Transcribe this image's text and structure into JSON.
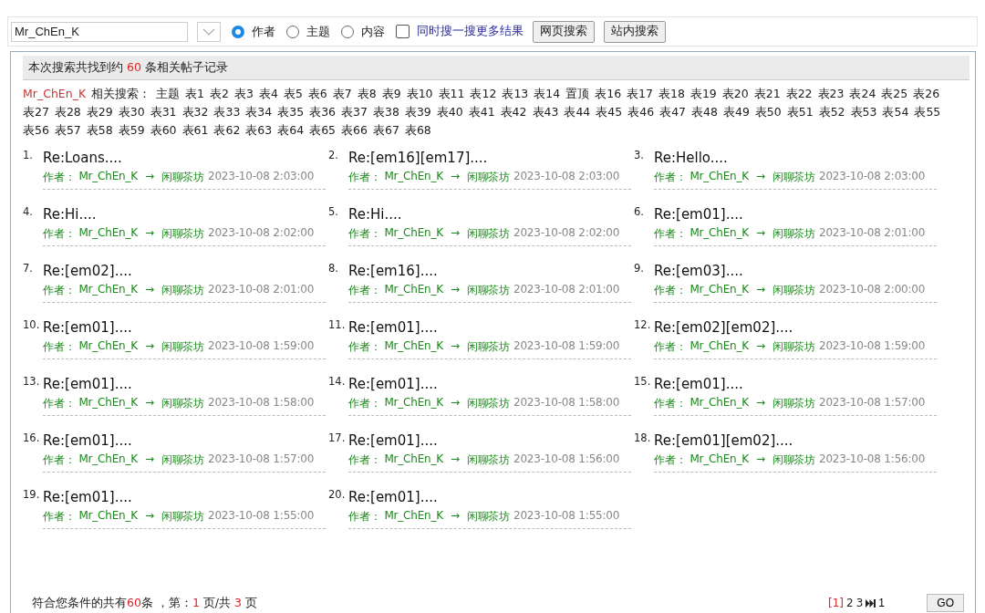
{
  "search_bar": {
    "query": "Mr_ChEn_K",
    "scopes": [
      {
        "label": "作者",
        "selected": true
      },
      {
        "label": "主题",
        "selected": false
      },
      {
        "label": "内容",
        "selected": false
      }
    ],
    "more_results": {
      "label": "同时搜一搜更多结果",
      "checked": false
    },
    "buttons": [
      "网页搜索",
      "站内搜索"
    ]
  },
  "summary": {
    "prefix": "本次搜索共找到约 ",
    "count": "60",
    "suffix": " 条相关帖子记录"
  },
  "related": {
    "user": "Mr_ChEn_K",
    "label": "相关搜索：",
    "tags": [
      "主题",
      "表1",
      "表2",
      "表3",
      "表4",
      "表5",
      "表6",
      "表7",
      "表8",
      "表9",
      "表10",
      "表11",
      "表12",
      "表13",
      "表14",
      "置顶",
      "表16",
      "表17",
      "表18",
      "表19",
      "表20",
      "表21",
      "表22",
      "表23",
      "表24",
      "表25",
      "表26",
      "表27",
      "表28",
      "表29",
      "表30",
      "表31",
      "表32",
      "表33",
      "表34",
      "表35",
      "表36",
      "表37",
      "表38",
      "表39",
      "表40",
      "表41",
      "表42",
      "表43",
      "表44",
      "表45",
      "表46",
      "表47",
      "表48",
      "表49",
      "表50",
      "表51",
      "表52",
      "表53",
      "表54",
      "表55",
      "表56",
      "表57",
      "表58",
      "表59",
      "表60",
      "表61",
      "表62",
      "表63",
      "表64",
      "表65",
      "表66",
      "表67",
      "表68"
    ]
  },
  "results": [
    {
      "number": "1.",
      "title": "Re:Loans....",
      "author_label": "作者：",
      "author": "Mr_ChEn_K",
      "arrow": "→",
      "forum": "闲聊茶坊",
      "time": "2023-10-08 2:03:00"
    },
    {
      "number": "2.",
      "title": "Re:[em16][em17]....",
      "author_label": "作者：",
      "author": "Mr_ChEn_K",
      "arrow": "→",
      "forum": "闲聊茶坊",
      "time": "2023-10-08 2:03:00"
    },
    {
      "number": "3.",
      "title": "Re:Hello....",
      "author_label": "作者：",
      "author": "Mr_ChEn_K",
      "arrow": "→",
      "forum": "闲聊茶坊",
      "time": "2023-10-08 2:03:00"
    },
    {
      "number": "4.",
      "title": "Re:Hi....",
      "author_label": "作者：",
      "author": "Mr_ChEn_K",
      "arrow": "→",
      "forum": "闲聊茶坊",
      "time": "2023-10-08 2:02:00"
    },
    {
      "number": "5.",
      "title": "Re:Hi....",
      "author_label": "作者：",
      "author": "Mr_ChEn_K",
      "arrow": "→",
      "forum": "闲聊茶坊",
      "time": "2023-10-08 2:02:00"
    },
    {
      "number": "6.",
      "title": "Re:[em01]....",
      "author_label": "作者：",
      "author": "Mr_ChEn_K",
      "arrow": "→",
      "forum": "闲聊茶坊",
      "time": "2023-10-08 2:01:00"
    },
    {
      "number": "7.",
      "title": "Re:[em02]....",
      "author_label": "作者：",
      "author": "Mr_ChEn_K",
      "arrow": "→",
      "forum": "闲聊茶坊",
      "time": "2023-10-08 2:01:00"
    },
    {
      "number": "8.",
      "title": "Re:[em16]....",
      "author_label": "作者：",
      "author": "Mr_ChEn_K",
      "arrow": "→",
      "forum": "闲聊茶坊",
      "time": "2023-10-08 2:01:00"
    },
    {
      "number": "9.",
      "title": "Re:[em03]....",
      "author_label": "作者：",
      "author": "Mr_ChEn_K",
      "arrow": "→",
      "forum": "闲聊茶坊",
      "time": "2023-10-08 2:00:00"
    },
    {
      "number": "10.",
      "title": "Re:[em01]....",
      "author_label": "作者：",
      "author": "Mr_ChEn_K",
      "arrow": "→",
      "forum": "闲聊茶坊",
      "time": "2023-10-08 1:59:00"
    },
    {
      "number": "11.",
      "title": "Re:[em01]....",
      "author_label": "作者：",
      "author": "Mr_ChEn_K",
      "arrow": "→",
      "forum": "闲聊茶坊",
      "time": "2023-10-08 1:59:00"
    },
    {
      "number": "12.",
      "title": "Re:[em02][em02]....",
      "author_label": "作者：",
      "author": "Mr_ChEn_K",
      "arrow": "→",
      "forum": "闲聊茶坊",
      "time": "2023-10-08 1:59:00"
    },
    {
      "number": "13.",
      "title": "Re:[em01]....",
      "author_label": "作者：",
      "author": "Mr_ChEn_K",
      "arrow": "→",
      "forum": "闲聊茶坊",
      "time": "2023-10-08 1:58:00"
    },
    {
      "number": "14.",
      "title": "Re:[em01]....",
      "author_label": "作者：",
      "author": "Mr_ChEn_K",
      "arrow": "→",
      "forum": "闲聊茶坊",
      "time": "2023-10-08 1:58:00"
    },
    {
      "number": "15.",
      "title": "Re:[em01]....",
      "author_label": "作者：",
      "author": "Mr_ChEn_K",
      "arrow": "→",
      "forum": "闲聊茶坊",
      "time": "2023-10-08 1:57:00"
    },
    {
      "number": "16.",
      "title": "Re:[em01]....",
      "author_label": "作者：",
      "author": "Mr_ChEn_K",
      "arrow": "→",
      "forum": "闲聊茶坊",
      "time": "2023-10-08 1:57:00"
    },
    {
      "number": "17.",
      "title": "Re:[em01]....",
      "author_label": "作者：",
      "author": "Mr_ChEn_K",
      "arrow": "→",
      "forum": "闲聊茶坊",
      "time": "2023-10-08 1:56:00"
    },
    {
      "number": "18.",
      "title": "Re:[em01][em02]....",
      "author_label": "作者：",
      "author": "Mr_ChEn_K",
      "arrow": "→",
      "forum": "闲聊茶坊",
      "time": "2023-10-08 1:56:00"
    },
    {
      "number": "19.",
      "title": "Re:[em01]....",
      "author_label": "作者：",
      "author": "Mr_ChEn_K",
      "arrow": "→",
      "forum": "闲聊茶坊",
      "time": "2023-10-08 1:55:00"
    },
    {
      "number": "20.",
      "title": "Re:[em01]....",
      "author_label": "作者：",
      "author": "Mr_ChEn_K",
      "arrow": "→",
      "forum": "闲聊茶坊",
      "time": "2023-10-08 1:55:00"
    }
  ],
  "footer": {
    "parts": [
      {
        "text": "符合您条件的共有",
        "kind": "plain"
      },
      {
        "text": "60",
        "kind": "number"
      },
      {
        "text": "条 ，第：",
        "kind": "plain"
      },
      {
        "text": "1",
        "kind": "number"
      },
      {
        "text": " 页/共 ",
        "kind": "plain"
      },
      {
        "text": "3",
        "kind": "number"
      },
      {
        "text": " 页",
        "kind": "plain"
      }
    ]
  },
  "pagination": {
    "pages": [
      {
        "label": "[1]",
        "selected": true
      },
      {
        "label": "2",
        "selected": false
      },
      {
        "label": "3",
        "selected": false
      }
    ],
    "page_input": "1",
    "go_button": "GO"
  }
}
